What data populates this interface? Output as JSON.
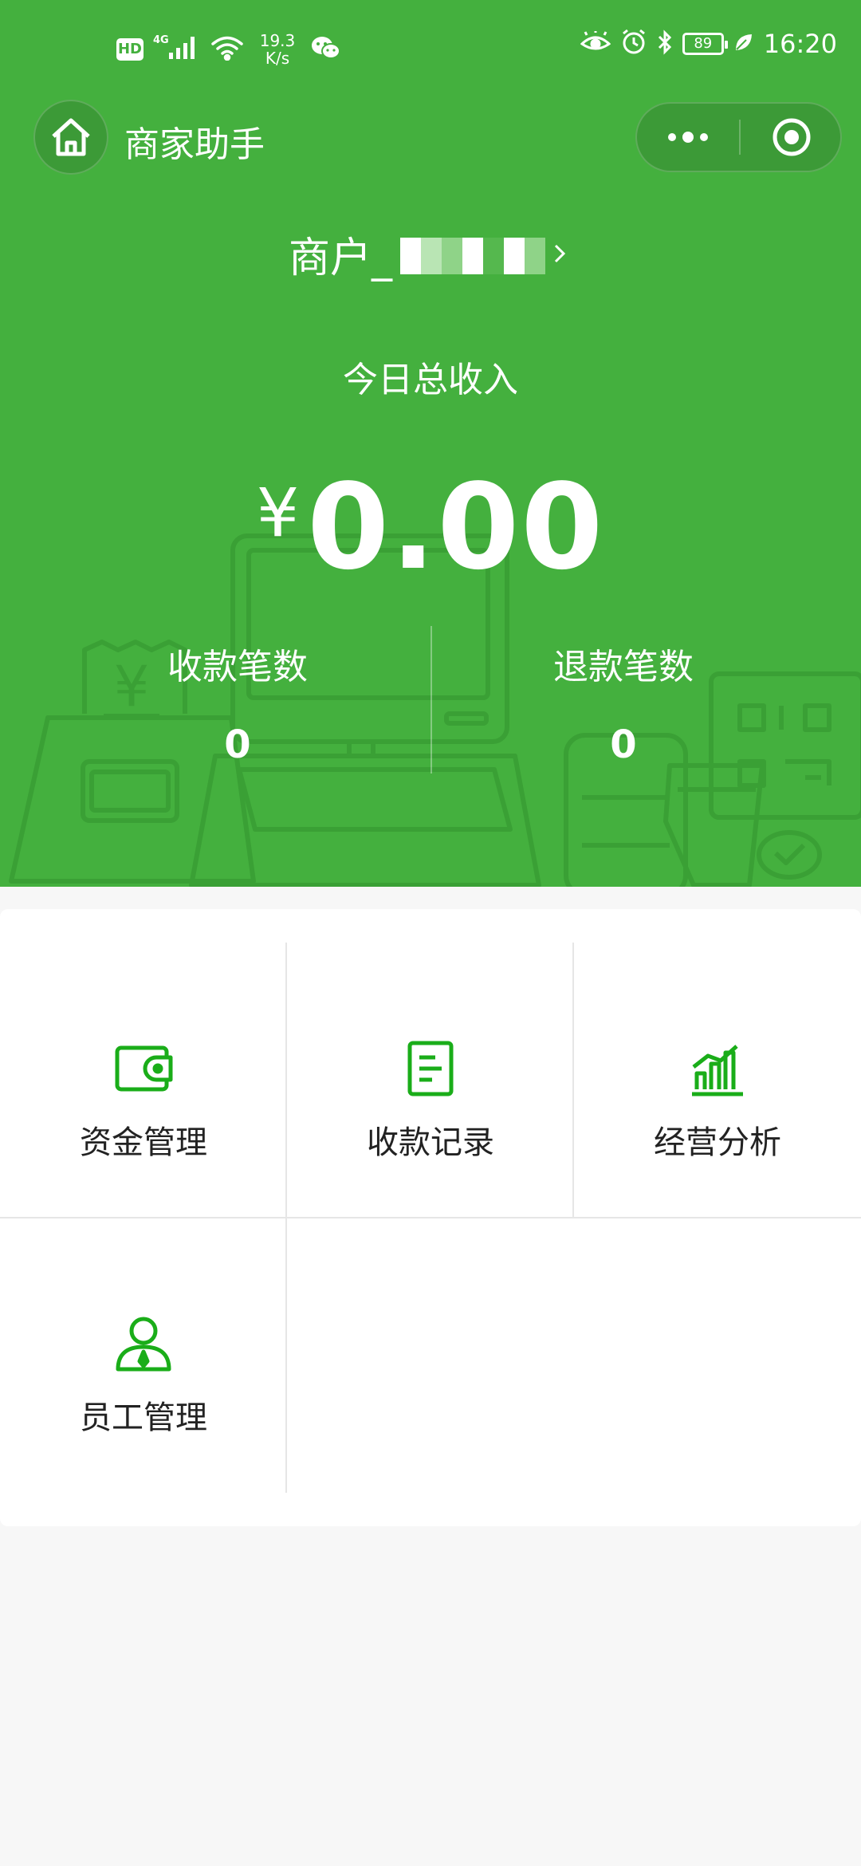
{
  "status_bar": {
    "hd": "HD",
    "network": "4G",
    "speed_value": "19.3",
    "speed_unit": "K/s",
    "battery": "89",
    "time": "16:20"
  },
  "nav": {
    "title": "商家助手",
    "home_icon": "home-icon",
    "more_icon": "more-dots-icon",
    "close_icon": "target-circle-icon"
  },
  "merchant": {
    "name": "商户_",
    "name_redacted": true
  },
  "summary": {
    "label": "今日总收入",
    "currency": "¥",
    "amount": "0.00",
    "stats": [
      {
        "label": "收款笔数",
        "value": "0"
      },
      {
        "label": "退款笔数",
        "value": "0"
      }
    ]
  },
  "menu": {
    "items": [
      {
        "label": "资金管理",
        "icon": "wallet-icon"
      },
      {
        "label": "收款记录",
        "icon": "document-icon"
      },
      {
        "label": "经营分析",
        "icon": "bar-chart-icon"
      },
      {
        "label": "员工管理",
        "icon": "staff-icon"
      }
    ]
  },
  "colors": {
    "header_bg": "#44b03e",
    "accent": "#1aad19",
    "page_bg": "#f7f7f7",
    "divider": "#e6e6e6"
  }
}
